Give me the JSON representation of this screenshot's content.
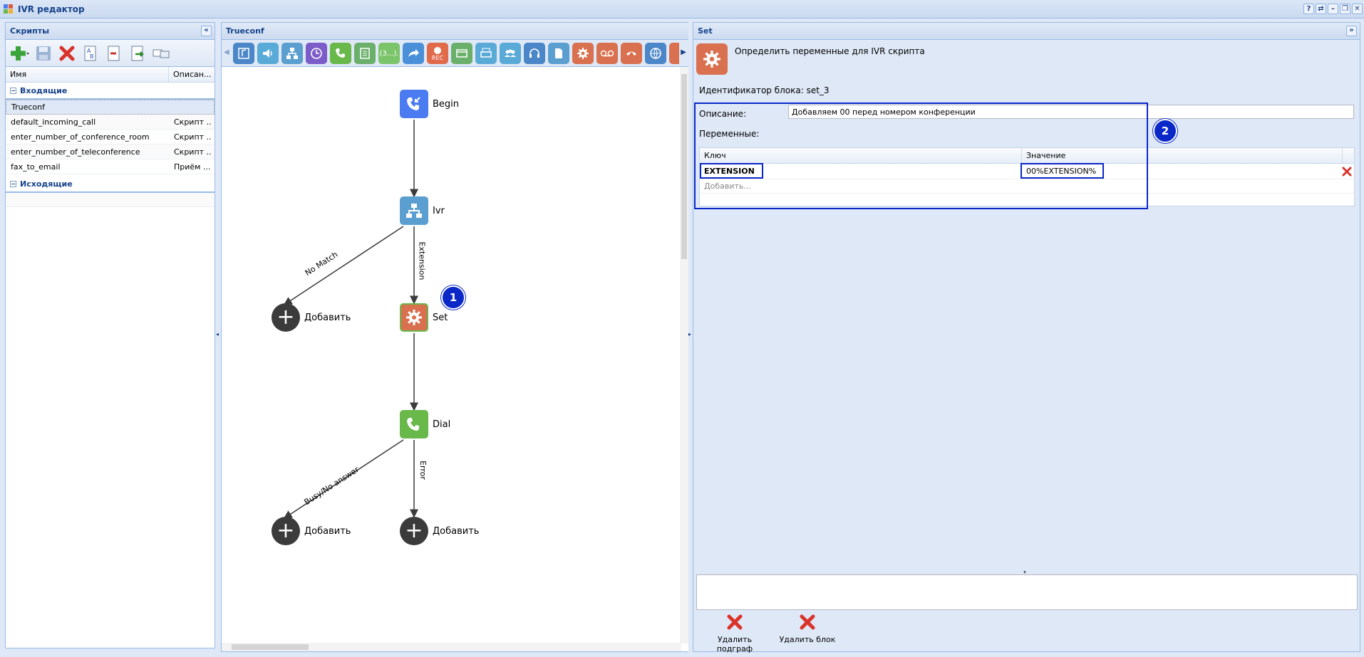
{
  "window": {
    "title": "IVR редактор",
    "tools": [
      "?",
      "⇄",
      "–",
      "❐",
      "✕"
    ]
  },
  "left": {
    "title": "Скрипты",
    "columns": [
      "Имя",
      "Описан..."
    ],
    "group_incoming": "Входящие",
    "group_outgoing": "Исходящие",
    "scripts": [
      {
        "name": "Trueconf",
        "desc": ""
      },
      {
        "name": "default_incoming_call",
        "desc": "Скрипт ..."
      },
      {
        "name": "enter_number_of_conference_room",
        "desc": "Скрипт ..."
      },
      {
        "name": "enter_number_of_teleconference",
        "desc": "Скрипт ..."
      },
      {
        "name": "fax_to_email",
        "desc": "Приём ..."
      }
    ]
  },
  "middle": {
    "title": "Trueconf",
    "block_counter_label": "(3...).",
    "rec_label": "REC",
    "nodes": {
      "begin": "Begin",
      "ivr": "Ivr",
      "set": "Set",
      "dial": "Dial"
    },
    "edges": {
      "no_match": "No Match",
      "extension": "Extension",
      "busy": "Busy/No answer",
      "error": "Error"
    },
    "add_label": "Добавить",
    "marker1": "1"
  },
  "right": {
    "title": "Set",
    "subtitle": "Определить переменные для IVR скрипта",
    "block_id": "Идентификатор блока: set_3",
    "desc_label": "Описание:",
    "desc_value": "Добавляем 00 перед номером конференции",
    "vars_label": "Переменные:",
    "col_key": "Ключ",
    "col_value": "Значение",
    "var_key": "EXTENSION",
    "var_value": "00%EXTENSION%",
    "add_more": "Добавить...",
    "marker2": "2",
    "delete_subgraph": "Удалить подграф",
    "delete_block": "Удалить блок"
  },
  "colors": {
    "accent": "#15428b",
    "marker": "#0a28c8",
    "node_begin": "#4a7bf0",
    "node_ivr": "#5a9fd0",
    "node_set": "#d9704f",
    "node_dial": "#68b84a"
  }
}
